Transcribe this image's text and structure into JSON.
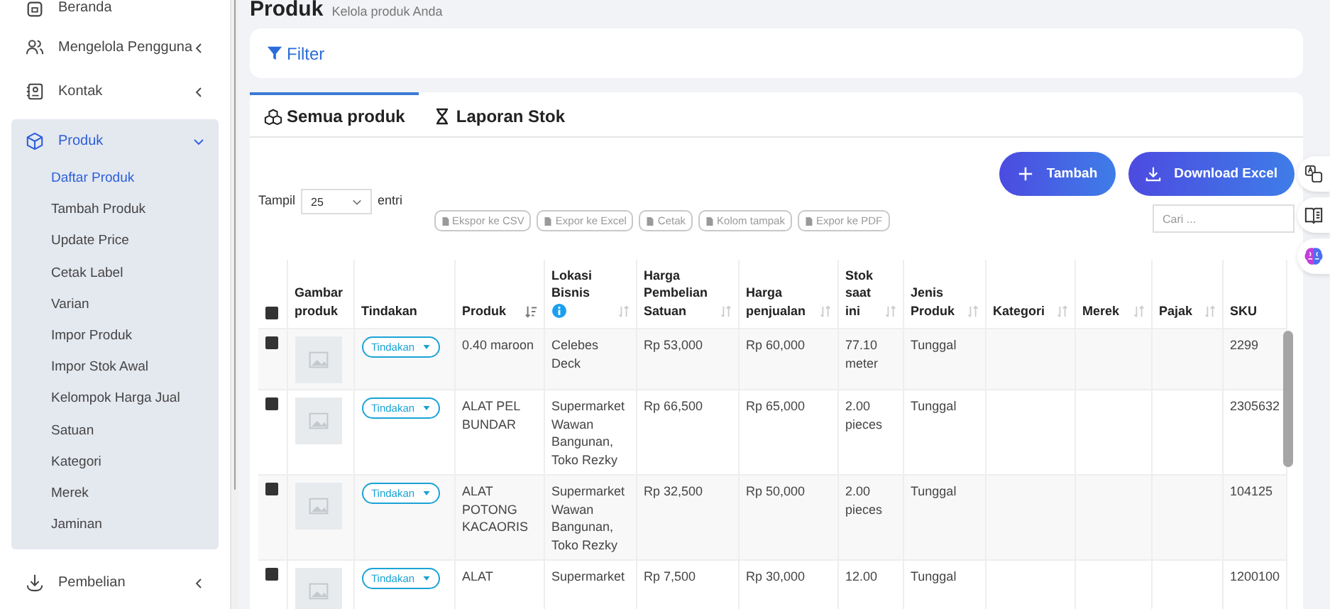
{
  "sidebar": {
    "items": [
      {
        "label": "Beranda",
        "has_submenu": false,
        "expanded": false
      },
      {
        "label": "Mengelola Pengguna",
        "has_submenu": true,
        "expanded": false
      },
      {
        "label": "Kontak",
        "has_submenu": true,
        "expanded": false
      },
      {
        "label": "Produk",
        "has_submenu": true,
        "expanded": true,
        "children": [
          {
            "label": "Daftar Produk",
            "selected": true
          },
          {
            "label": "Tambah Produk",
            "selected": false
          },
          {
            "label": "Update Price",
            "selected": false
          },
          {
            "label": "Cetak Label",
            "selected": false
          },
          {
            "label": "Varian",
            "selected": false
          },
          {
            "label": "Impor Produk",
            "selected": false
          },
          {
            "label": "Impor Stok Awal",
            "selected": false
          },
          {
            "label": "Kelompok Harga Jual",
            "selected": false
          },
          {
            "label": "Satuan",
            "selected": false
          },
          {
            "label": "Kategori",
            "selected": false
          },
          {
            "label": "Merek",
            "selected": false
          },
          {
            "label": "Jaminan",
            "selected": false
          }
        ]
      },
      {
        "label": "Pembelian",
        "has_submenu": true,
        "expanded": false
      }
    ]
  },
  "page": {
    "title": "Produk",
    "subtitle": "Kelola produk Anda"
  },
  "filter": {
    "label": "Filter"
  },
  "tabs": [
    {
      "label": "Semua produk",
      "selected": true
    },
    {
      "label": "Laporan Stok",
      "selected": false
    }
  ],
  "toolbar": {
    "show_label": "Tampil",
    "page_size": "25",
    "entries_label": "entri",
    "export_buttons": [
      {
        "label": "Ekspor ke CSV",
        "disabled": true
      },
      {
        "label": "Expor ke Excel",
        "disabled": true
      },
      {
        "label": "Cetak",
        "disabled": true
      },
      {
        "label": "Kolom tampak",
        "disabled": true
      },
      {
        "label": "Expor ke PDF",
        "disabled": true
      }
    ],
    "add_button": "Tambah",
    "download_button": "Download Excel",
    "search": {
      "placeholder": "Cari ..."
    }
  },
  "table": {
    "select_all_checked": false,
    "columns": [
      {
        "label": "Gambar produk",
        "sortable": false,
        "sorted": false,
        "info": false
      },
      {
        "label": "Tindakan",
        "sortable": false,
        "sorted": false,
        "info": false
      },
      {
        "label": "Produk",
        "sortable": true,
        "sorted": true,
        "info": false
      },
      {
        "label": "Lokasi Bisnis",
        "sortable": true,
        "sorted": false,
        "info": true
      },
      {
        "label": "Harga Pembelian Satuan",
        "sortable": true,
        "sorted": false,
        "info": false
      },
      {
        "label": "Harga penjualan",
        "sortable": true,
        "sorted": false,
        "info": false
      },
      {
        "label": "Stok saat ini",
        "sortable": true,
        "sorted": false,
        "info": false
      },
      {
        "label": "Jenis Produk",
        "sortable": true,
        "sorted": false,
        "info": false
      },
      {
        "label": "Kategori",
        "sortable": true,
        "sorted": false,
        "info": false
      },
      {
        "label": "Merek",
        "sortable": true,
        "sorted": false,
        "info": false
      },
      {
        "label": "Pajak",
        "sortable": true,
        "sorted": false,
        "info": false
      },
      {
        "label": "SKU",
        "sortable": false,
        "sorted": false,
        "info": false
      }
    ],
    "rows": [
      {
        "checked": false,
        "action": "Tindakan",
        "product": "0.40 maroon",
        "location": "Celebes Deck",
        "buy": "Rp 53,000",
        "sell": "Rp 60,000",
        "stock": "77.10 meter",
        "type": "Tunggal",
        "sku": "2299"
      },
      {
        "checked": false,
        "action": "Tindakan",
        "product": "ALAT PEL BUNDAR",
        "location": "Supermarket Wawan Bangunan, Toko Rezky",
        "buy": "Rp 66,500",
        "sell": "Rp 65,000",
        "stock": "2.00 pieces",
        "type": "Tunggal",
        "sku": "2305632"
      },
      {
        "checked": false,
        "action": "Tindakan",
        "product": "ALAT POTONG KACAORIS",
        "location": "Supermarket Wawan Bangunan, Toko Rezky",
        "buy": "Rp 32,500",
        "sell": "Rp 50,000",
        "stock": "2.00 pieces",
        "type": "Tunggal",
        "sku": "104125"
      },
      {
        "checked": false,
        "action": "Tindakan",
        "product": "ALAT",
        "location": "Supermarket",
        "buy": "Rp 7,500",
        "sell": "Rp 30,000",
        "stock": "12.00",
        "type": "Tunggal",
        "sku": "1200100"
      }
    ]
  }
}
